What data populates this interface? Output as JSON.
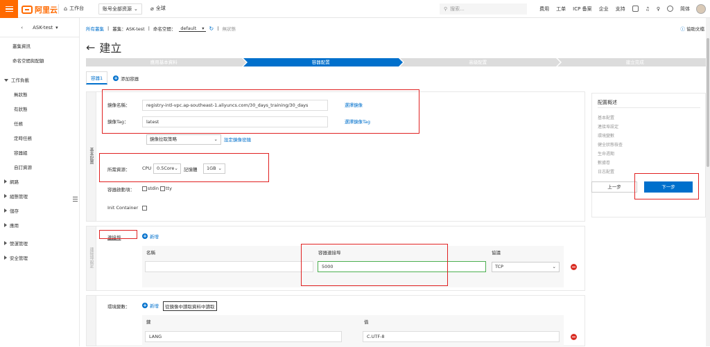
{
  "topbar": {
    "logo_text": "阿里云",
    "workbench": "工作台",
    "account_resources": "账号全部资源",
    "region": "全球",
    "search_placeholder": "搜索...",
    "links": [
      "费用",
      "工单",
      "ICP 备案",
      "企业",
      "支持"
    ],
    "lang": "简体"
  },
  "sidebar": {
    "cluster": "ASK-test",
    "items": [
      {
        "label": "叢集資訊"
      },
      {
        "label": "命名空間與配額"
      },
      {
        "label": "工作負載"
      },
      {
        "label": "無狀態"
      },
      {
        "label": "有狀態"
      },
      {
        "label": "任務"
      },
      {
        "label": "定時任務"
      },
      {
        "label": "容器組"
      },
      {
        "label": "自訂資源"
      },
      {
        "label": "網路"
      },
      {
        "label": "組態管理"
      },
      {
        "label": "儲存"
      },
      {
        "label": "應用"
      },
      {
        "label": "營運管理"
      },
      {
        "label": "安全管理"
      }
    ]
  },
  "breadcrumb": {
    "root": "所有叢集",
    "cluster": "叢集：ASK-test",
    "ns_label": "命名空間：",
    "ns_value": "default",
    "current": "無狀態"
  },
  "help": "協助文檔",
  "page_title": "建立",
  "steps": [
    "應用基本資料",
    "容器配置",
    "高級配置",
    "建立完成"
  ],
  "tabs": {
    "container": "容器1",
    "add": "添加容器"
  },
  "basic": {
    "section": "基本配置",
    "image_name_label": "鏡像名稱：",
    "image_name_value": "registry-intl-vpc.ap-southeast-1.aliyuncs.com/30_days_training/30_days",
    "select_image": "選擇鏡像",
    "image_tag_label": "鏡像Tag：",
    "image_tag_value": "latest",
    "select_tag": "選擇鏡像Tag",
    "pull_policy": "鏡像拉取策略",
    "set_secret": "設定鏡像密鑰",
    "resources_label": "所需資源：",
    "cpu_label": "CPU",
    "cpu_value": "0.5Core",
    "mem_label": "記憶體",
    "mem_value": "1GB",
    "startup_label": "容器啟動項：",
    "stdin": "stdin",
    "tty": "tty",
    "init_label": "Init Container"
  },
  "ports": {
    "section": "連接埠設定",
    "label": "連接埠",
    "add": "新增",
    "col_name": "名稱",
    "col_port": "容器連接埠",
    "col_protocol": "協議",
    "name_value": "",
    "port_value": "5000",
    "protocol_value": "TCP"
  },
  "env": {
    "label": "環境變數：",
    "add": "新增",
    "import": "從鏡像中讀取資料中讀取",
    "col_key": "鍵",
    "col_value": "值",
    "key_value": "LANG",
    "val_value": "C.UTF-8"
  },
  "summary": {
    "title": "配置概述",
    "items": [
      "基本配置",
      "連接埠設定",
      "環境變數",
      "健全狀態檢查",
      "生命週期",
      "數據卷",
      "日志配置"
    ]
  },
  "buttons": {
    "prev": "上一步",
    "next": "下一步"
  }
}
